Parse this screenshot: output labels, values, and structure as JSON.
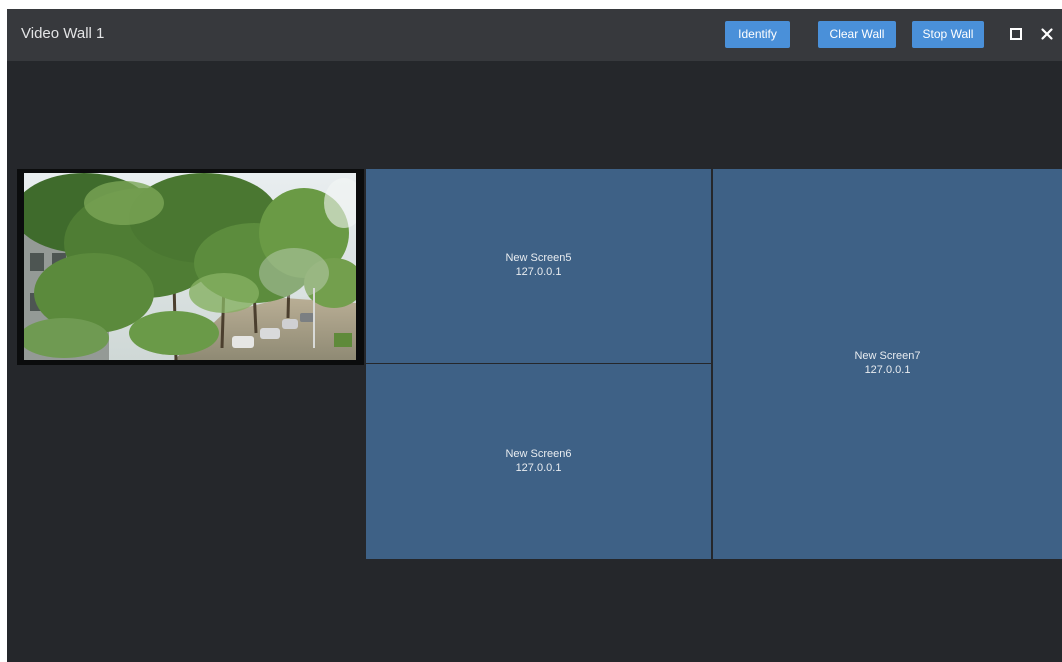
{
  "window": {
    "title": "Video Wall 1"
  },
  "toolbar": {
    "identify_label": "Identify",
    "clear_wall_label": "Clear Wall",
    "stop_wall_label": "Stop Wall",
    "maximize_icon": "maximize-icon",
    "close_icon": "close-icon"
  },
  "colors": {
    "accent_button": "#4a90d9",
    "titlebar": "#37393d",
    "background": "#25272b",
    "screen_fill": "#3e6186"
  },
  "wall": {
    "video_cell": {
      "content": "live camera feed (trees and buildings)"
    },
    "screens": [
      {
        "name": "New Screen5",
        "ip": "127.0.0.1"
      },
      {
        "name": "New Screen6",
        "ip": "127.0.0.1"
      },
      {
        "name": "New Screen7",
        "ip": "127.0.0.1"
      }
    ]
  }
}
